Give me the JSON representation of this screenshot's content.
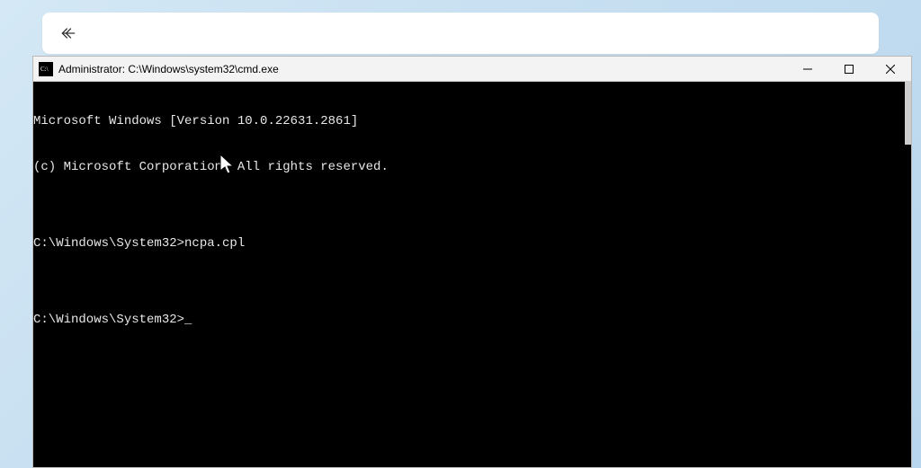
{
  "back_card": {
    "label": "Back"
  },
  "window": {
    "title": "Administrator: C:\\Windows\\system32\\cmd.exe",
    "icon_text": "C:\\"
  },
  "terminal": {
    "lines": [
      "Microsoft Windows [Version 10.0.22631.2861]",
      "(c) Microsoft Corporation. All rights reserved.",
      "",
      "C:\\Windows\\System32>ncpa.cpl",
      "",
      "C:\\Windows\\System32>_"
    ]
  }
}
